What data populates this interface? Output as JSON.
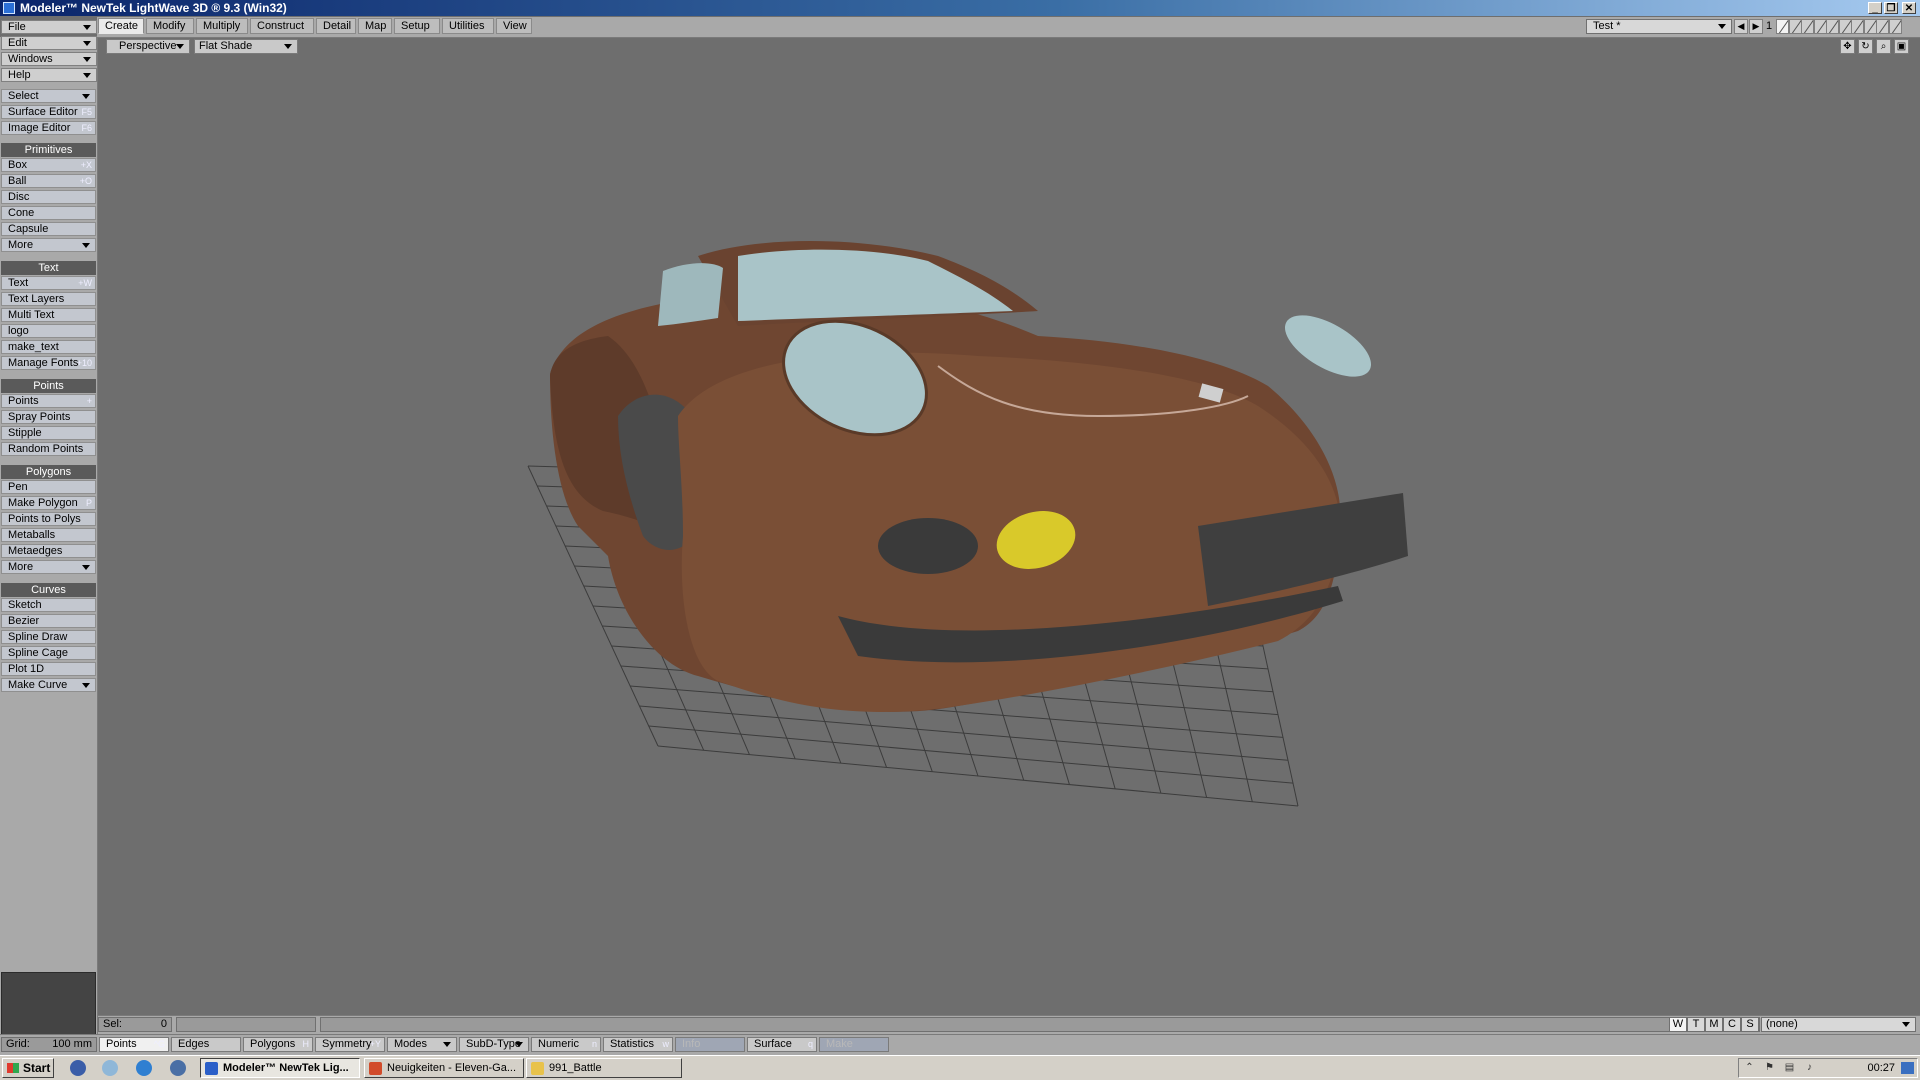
{
  "window": {
    "title": "Modeler™ NewTek LightWave 3D ® 9.3 (Win32)",
    "buttons": [
      "_",
      "❐",
      "✕"
    ]
  },
  "menus": [
    {
      "label": "File"
    },
    {
      "label": "Edit"
    },
    {
      "label": "Windows"
    },
    {
      "label": "Help"
    }
  ],
  "tabs": [
    "Create",
    "Modify",
    "Multiply",
    "Construct",
    "Detail",
    "Map",
    "Setup",
    "Utilities",
    "View"
  ],
  "active_tab": "Create",
  "layers": {
    "object": "Test *",
    "current_layer": "1"
  },
  "viewport": {
    "view": "Perspective",
    "shade": "Flat Shade"
  },
  "left_panel": {
    "top_buttons": [
      {
        "label": "Select",
        "shortcut": "",
        "dropdown": true
      },
      {
        "label": "Surface Editor",
        "shortcut": "F5"
      },
      {
        "label": "Image Editor",
        "shortcut": "F6"
      }
    ],
    "sections": [
      {
        "title": "Primitives",
        "items": [
          {
            "label": "Box",
            "shortcut": "+X"
          },
          {
            "label": "Ball",
            "shortcut": "+O"
          },
          {
            "label": "Disc",
            "shortcut": ""
          },
          {
            "label": "Cone",
            "shortcut": ""
          },
          {
            "label": "Capsule",
            "shortcut": ""
          },
          {
            "label": "More",
            "shortcut": "",
            "dropdown": true
          }
        ]
      },
      {
        "title": "Text",
        "items": [
          {
            "label": "Text",
            "shortcut": "+W"
          },
          {
            "label": "Text Layers",
            "shortcut": ""
          },
          {
            "label": "Multi Text",
            "shortcut": ""
          },
          {
            "label": "logo",
            "shortcut": ""
          },
          {
            "label": "make_text",
            "shortcut": ""
          },
          {
            "label": "Manage Fonts",
            "shortcut": "+10"
          }
        ]
      },
      {
        "title": "Points",
        "items": [
          {
            "label": "Points",
            "shortcut": "+"
          },
          {
            "label": "Spray Points",
            "shortcut": ""
          },
          {
            "label": "Stipple",
            "shortcut": ""
          },
          {
            "label": "Random Points",
            "shortcut": ""
          }
        ]
      },
      {
        "title": "Polygons",
        "items": [
          {
            "label": "Pen",
            "shortcut": ""
          },
          {
            "label": "Make Polygon",
            "shortcut": "P"
          },
          {
            "label": "Points to Polys",
            "shortcut": ""
          },
          {
            "label": "Metaballs",
            "shortcut": ""
          },
          {
            "label": "Metaedges",
            "shortcut": ""
          },
          {
            "label": "More",
            "shortcut": "",
            "dropdown": true
          }
        ]
      },
      {
        "title": "Curves",
        "items": [
          {
            "label": "Sketch",
            "shortcut": ""
          },
          {
            "label": "Bezier",
            "shortcut": ""
          },
          {
            "label": "Spline Draw",
            "shortcut": ""
          },
          {
            "label": "Spline Cage",
            "shortcut": ""
          },
          {
            "label": "Plot 1D",
            "shortcut": ""
          },
          {
            "label": "Make Curve",
            "shortcut": "",
            "dropdown": true
          }
        ]
      }
    ]
  },
  "status": {
    "sel_label": "Sel:",
    "sel_value": "0",
    "wtmcs": [
      "W",
      "T",
      "M",
      "C",
      "S"
    ],
    "surface": "(none)"
  },
  "mode_bar": {
    "grid_label": "Grid:",
    "grid_value": "100 mm",
    "buttons": [
      {
        "label": "Points",
        "shortcut": "^G",
        "active": true
      },
      {
        "label": "Edges",
        "shortcut": "",
        "active": false
      },
      {
        "label": "Polygons",
        "shortcut": "H",
        "active": false
      },
      {
        "label": "Symmetry",
        "shortcut": "+Y",
        "active": false
      },
      {
        "label": "Modes",
        "shortcut": "",
        "dropdown": true
      },
      {
        "label": "SubD-Type",
        "shortcut": "",
        "dropdown": true
      },
      {
        "label": "Numeric",
        "shortcut": "n",
        "active": false
      },
      {
        "label": "Statistics",
        "shortcut": "w",
        "active": false
      },
      {
        "label": "Info",
        "shortcut": "",
        "disabled": true
      },
      {
        "label": "Surface",
        "shortcut": "q",
        "active": false
      },
      {
        "label": "Make",
        "shortcut": "",
        "disabled": true
      }
    ]
  },
  "taskbar": {
    "start": "Start",
    "tasks": [
      {
        "label": "Modeler™ NewTek Lig...",
        "active": true,
        "icon_color": "#2b5fc8"
      },
      {
        "label": "Neuigkeiten - Eleven-Ga...",
        "active": false,
        "icon_color": "#d24b2a"
      },
      {
        "label": "991_Battle",
        "active": false,
        "icon_color": "#e8c24a"
      }
    ],
    "clock": "00:27"
  },
  "colors": {
    "car_body": "#7a4f36",
    "glass": "#a9c4c8",
    "fog_light": "#d9c92a",
    "viewport_bg": "#6e6e6e",
    "grid": "#3a3a3a"
  }
}
